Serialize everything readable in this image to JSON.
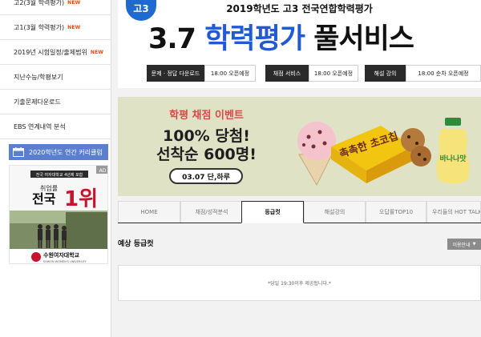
{
  "sidebar": {
    "items": [
      {
        "label": "고2(3월 학력평가)",
        "badge": "NEW"
      },
      {
        "label": "고1(3월 학력평가)",
        "badge": "NEW"
      },
      {
        "label": "2019년 시험일정/출제범위",
        "badge": "NEW"
      },
      {
        "label": "지난수능/학평보기",
        "badge": ""
      },
      {
        "label": "기출문제다운로드",
        "badge": ""
      },
      {
        "label": "EBS 연계내역 분석",
        "badge": ""
      }
    ],
    "curriculum_label": "2020학년도 연간 커리큘럼",
    "ad": {
      "tag": "AD",
      "caption": "전국 여자대학교 4년제 포함",
      "rank_prefix": "취업률",
      "rank_word": "전국",
      "rank": "1위",
      "school_name": "수원여자대학교",
      "school_name_en": "SUWON WOMEN'S UNIVERSITY"
    }
  },
  "header": {
    "grade_badge": "고3",
    "subtitle": "2019학년도 고3 전국연합학력평가",
    "headline_num": "3.7",
    "headline_main": "학력평가",
    "headline_tail": "풀서비스",
    "schedule": [
      {
        "label": "문제 · 정답 다운로드",
        "value": "18:00 오픈예정"
      },
      {
        "label": "채점 서비스",
        "value": "18:00 오픈예정"
      },
      {
        "label": "해설 강의",
        "value": "18:00 순차 오픈예정"
      }
    ]
  },
  "banner": {
    "title": "학평 채점 이벤트",
    "line1": "100% 당첨!",
    "line2": "선착순 600명!",
    "date": "03.07 단,하루",
    "product_snack": "촉촉한 초코칩",
    "product_drink": "바나나맛"
  },
  "tabs": [
    {
      "label": "HOME",
      "active": false
    },
    {
      "label": "채점/성적분석",
      "active": false
    },
    {
      "label": "등급컷",
      "active": true
    },
    {
      "label": "해설강의",
      "active": false
    },
    {
      "label": "오답률TOP10",
      "active": false
    },
    {
      "label": "우리들의 HOT TALK",
      "active": false
    }
  ],
  "content": {
    "section_title": "예상 등급컷",
    "info_button": "이용안내",
    "notice": "*당일 19:30이후 제공됩니다.*"
  },
  "colors": {
    "accent_blue": "#2259d4",
    "new_badge": "#e8480c",
    "curriculum_bar": "#5a7fd0",
    "banner_bg": "#dfe2c4",
    "banner_red": "#d64a4a"
  }
}
